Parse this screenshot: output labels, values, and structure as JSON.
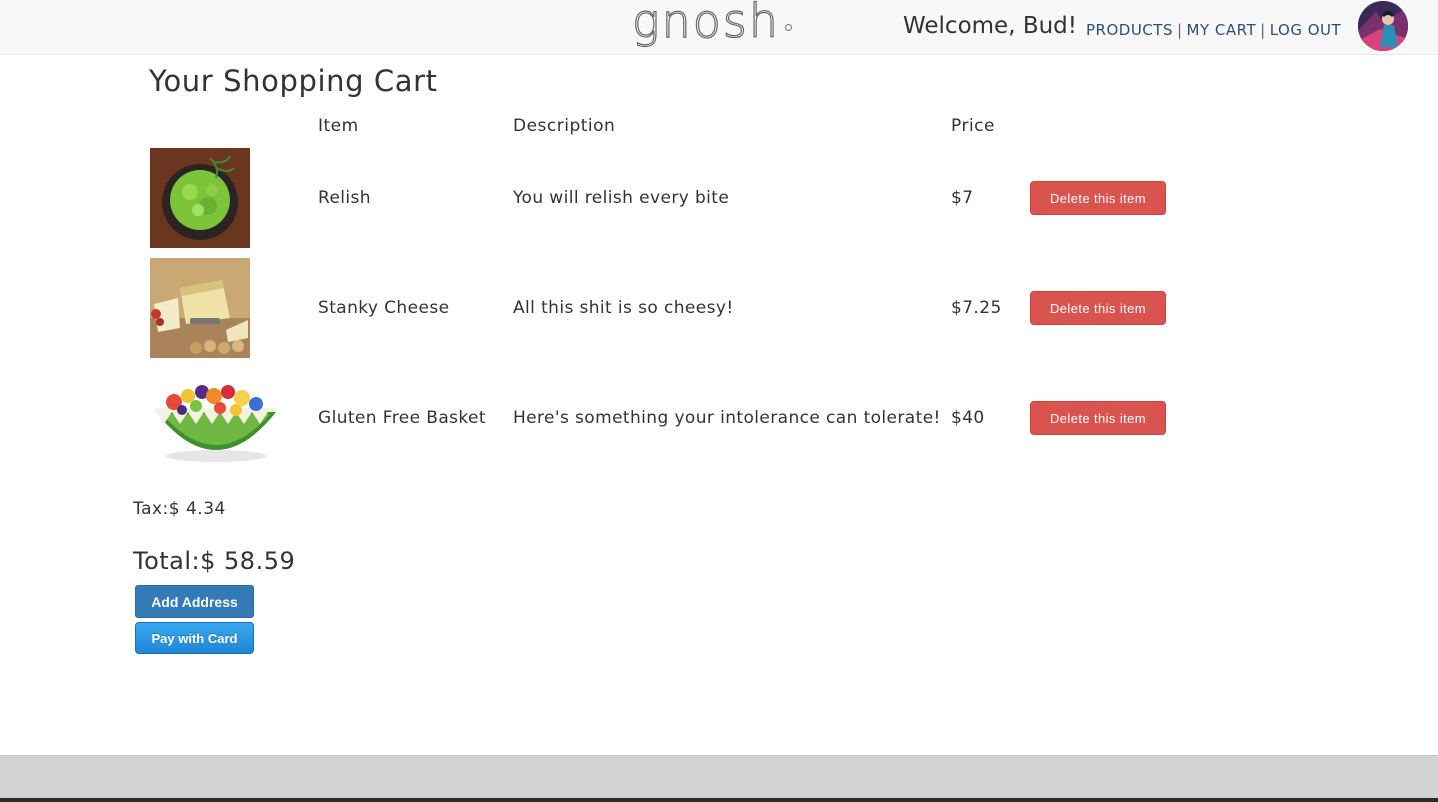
{
  "brand": {
    "logo_text": "gnosh"
  },
  "header": {
    "welcome": "Welcome, Bud!",
    "nav": {
      "products": "PRODUCTS",
      "my_cart": "MY CART",
      "log_out": "LOG OUT",
      "separator": "|"
    },
    "avatar_icon": "user-avatar"
  },
  "cart": {
    "title": "Your Shopping Cart",
    "columns": {
      "item": "Item",
      "description": "Description",
      "price": "Price"
    },
    "items": [
      {
        "name": "Relish",
        "description": "You will relish every bite",
        "price": "$7",
        "delete_label": "Delete this item",
        "image": "relish-image"
      },
      {
        "name": "Stanky Cheese",
        "description": "All this shit is so cheesy!",
        "price": "$7.25",
        "delete_label": "Delete this item",
        "image": "cheese-image"
      },
      {
        "name": "Gluten Free Basket",
        "description": "Here's something your intolerance can tolerate!",
        "price": "$40",
        "delete_label": "Delete this item",
        "image": "fruit-basket-image"
      }
    ],
    "tax_label": "Tax:$ 4.34",
    "total_label": "Total:$ 58.59",
    "add_address_label": "Add Address",
    "pay_label": "Pay with Card"
  },
  "colors": {
    "danger": "#d9534f",
    "primary": "#337ab7",
    "stripe_blue": "#1f86d8"
  }
}
